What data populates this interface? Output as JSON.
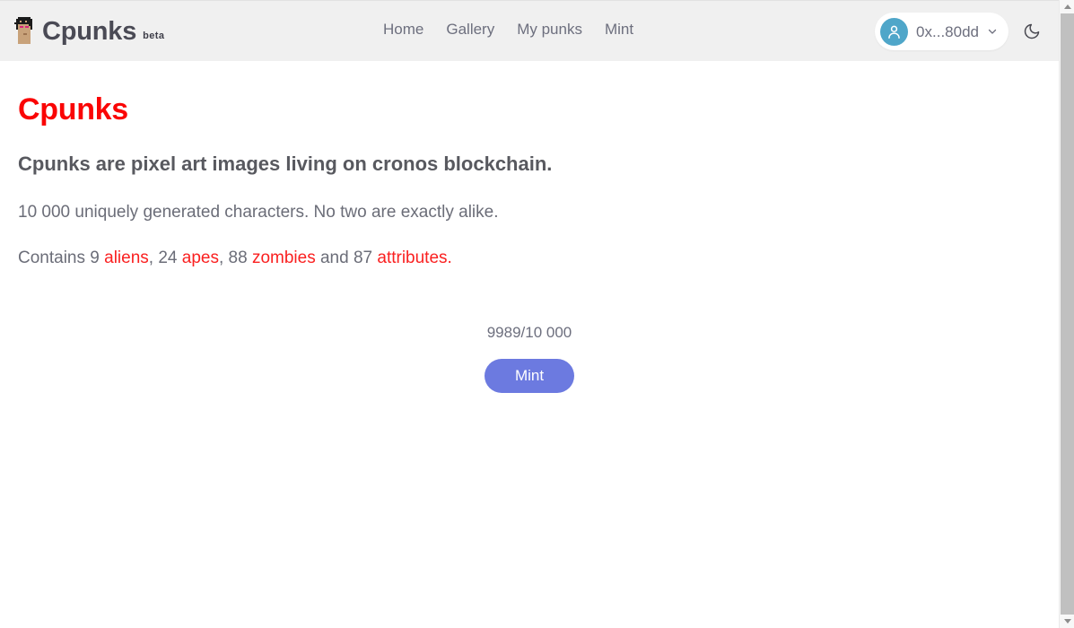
{
  "header": {
    "brand": {
      "name": "Cpunks",
      "beta_label": "beta",
      "avatar_icon": "pixel-punk-avatar-icon"
    },
    "nav": [
      {
        "label": "Home"
      },
      {
        "label": "Gallery"
      },
      {
        "label": "My punks"
      },
      {
        "label": "Mint"
      }
    ],
    "wallet": {
      "address": "0x...80dd",
      "avatar_icon": "user-avatar-icon",
      "chevron_icon": "chevron-down-icon",
      "avatar_color": "#4fa6c9"
    },
    "theme_toggle": {
      "icon": "moon-icon",
      "mode": "dark-mode-toggle"
    },
    "background_color": "#f0f0f0"
  },
  "main": {
    "title": "Cpunks",
    "title_color": "#fa0505",
    "subtitle": "Cpunks are pixel art images living on cronos blockchain.",
    "paragraph": "10 000 uniquely generated characters. No two are exactly alike.",
    "contains": {
      "lead": "Contains 9 ",
      "aliens_link": "aliens",
      "sep1": ", 24 ",
      "apes_link": "apes",
      "sep2": ", 88 ",
      "zombies_link": "zombies",
      "sep3": " and 87 ",
      "attributes_link": "attributes",
      "end": "."
    },
    "mint": {
      "counter": "9989/10 000",
      "minted": 9989,
      "total": "10 000",
      "button_label": "Mint",
      "button_color": "#6c7ae0"
    }
  },
  "scrollbar": {
    "up_arrow_icon": "scroll-up-arrow-icon",
    "down_arrow_icon": "scroll-down-arrow-icon"
  }
}
